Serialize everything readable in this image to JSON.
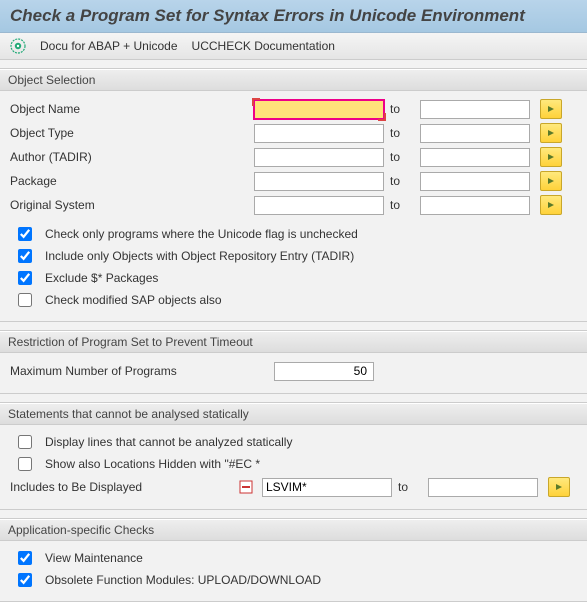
{
  "title": "Check a Program Set for Syntax Errors in Unicode Environment",
  "toolbar": {
    "docu_link": "Docu for ABAP + Unicode",
    "uccheck_doc": "UCCHECK Documentation"
  },
  "to_label": "to",
  "sections": {
    "obj_sel": {
      "title": "Object Selection",
      "rows": {
        "object_name": {
          "label": "Object Name",
          "from": "",
          "to": ""
        },
        "object_type": {
          "label": "Object Type",
          "from": "",
          "to": ""
        },
        "author": {
          "label": "Author (TADIR)",
          "from": "",
          "to": ""
        },
        "package": {
          "label": "Package",
          "from": "",
          "to": ""
        },
        "orig_system": {
          "label": "Original System",
          "from": "",
          "to": ""
        }
      },
      "checks": {
        "c1": {
          "label": "Check only programs where the Unicode flag is unchecked",
          "checked": true
        },
        "c2": {
          "label": "Include only Objects with Object Repository Entry (TADIR)",
          "checked": true
        },
        "c3": {
          "label": "Exclude $* Packages",
          "checked": true
        },
        "c4": {
          "label": "Check modified SAP objects also",
          "checked": false
        }
      }
    },
    "restriction": {
      "title": "Restriction of Program Set to Prevent Timeout",
      "max_programs_label": "Maximum Number of Programs",
      "max_programs_value": "50"
    },
    "stmts": {
      "title": "Statements that cannot be analysed statically",
      "checks": {
        "s1": {
          "label": "Display lines that cannot be analyzed statically",
          "checked": false
        },
        "s2": {
          "label": "Show also Locations Hidden with \"#EC *",
          "checked": false
        }
      },
      "includes": {
        "label": "Includes to Be Displayed",
        "from": "LSVIM*",
        "to": ""
      }
    },
    "app_checks": {
      "title": "Application-specific Checks",
      "checks": {
        "a1": {
          "label": "View Maintenance",
          "checked": true
        },
        "a2": {
          "label": "Obsolete Function Modules: UPLOAD/DOWNLOAD",
          "checked": true
        }
      }
    }
  }
}
